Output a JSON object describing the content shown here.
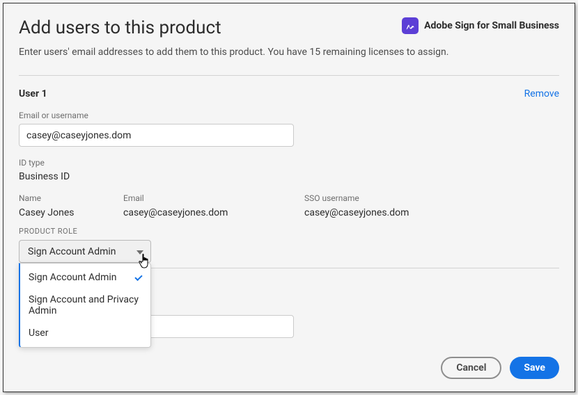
{
  "header": {
    "title": "Add users to this product",
    "product_name": "Adobe Sign for Small Business",
    "subtitle": "Enter users' email addresses to add them to this product. You have 15 remaining licenses to assign."
  },
  "users": [
    {
      "section_title": "User 1",
      "remove_label": "Remove",
      "email_label": "Email or username",
      "email_input": "casey@caseyjones.dom",
      "idtype_label": "ID type",
      "idtype_value": "Business ID",
      "columns": {
        "name_label": "Name",
        "name_value": "Casey Jones",
        "email_label": "Email",
        "email_value": "casey@caseyjones.dom",
        "sso_label": "SSO username",
        "sso_value": "casey@caseyjones.dom"
      },
      "product_role": {
        "label": "PRODUCT ROLE",
        "selected": "Sign Account Admin",
        "options": [
          "Sign Account Admin",
          "Sign Account and Privacy Admin",
          "User"
        ]
      }
    }
  ],
  "footer": {
    "cancel_label": "Cancel",
    "save_label": "Save"
  }
}
